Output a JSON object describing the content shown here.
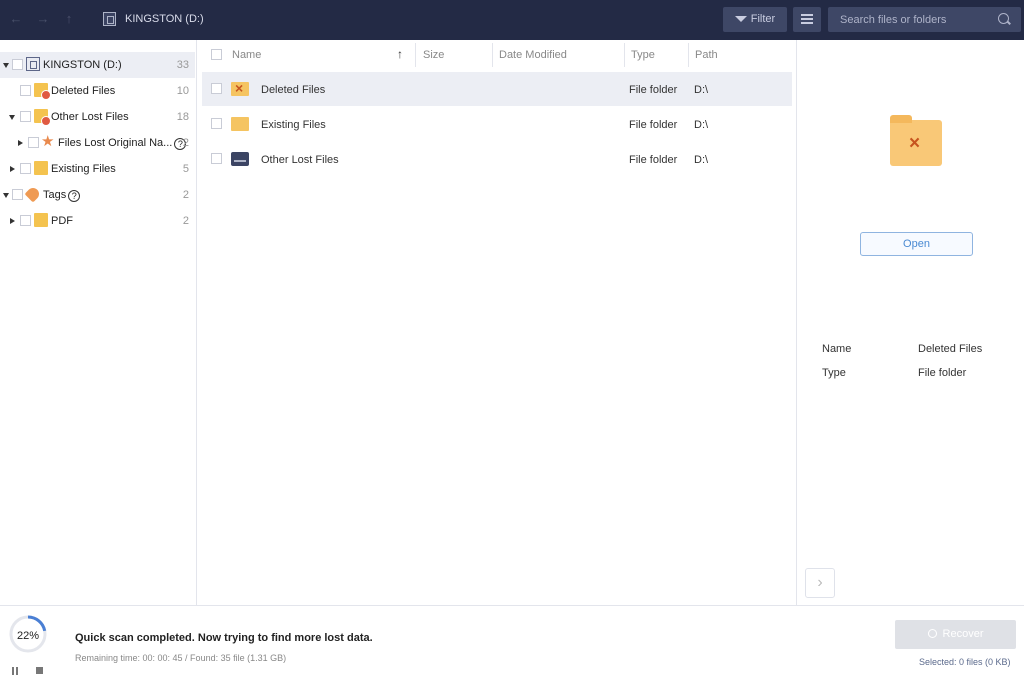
{
  "topbar": {
    "title": "KINGSTON (D:)",
    "filter_label": "Filter",
    "search_placeholder": "Search files or folders",
    "back_glyph": "←",
    "forward_glyph": "→",
    "up_glyph": "↑"
  },
  "tree": {
    "items": [
      {
        "label": "KINGSTON (D:)",
        "count": "33",
        "icon": "drive-icon"
      },
      {
        "label": "Deleted Files",
        "count": "10",
        "icon": "deleted-folder-icon"
      },
      {
        "label": "Other Lost Files",
        "count": "18",
        "icon": "lost-folder-icon"
      },
      {
        "label": "Files Lost Original Na...",
        "count": "2",
        "icon": "star-icon"
      },
      {
        "label": "Existing Files",
        "count": "5",
        "icon": "folder-icon"
      },
      {
        "label": "Tags",
        "count": "2",
        "icon": "tag-icon"
      },
      {
        "label": "PDF",
        "count": "2",
        "icon": "folder-icon"
      }
    ],
    "help_glyph": "?"
  },
  "list": {
    "columns": [
      "Name",
      "Size",
      "Date Modified",
      "Type",
      "Path"
    ],
    "sort_glyph": "↑",
    "rows": [
      {
        "name": "Deleted Files",
        "type": "File folder",
        "path": "D:\\"
      },
      {
        "name": "Existing Files",
        "type": "File folder",
        "path": "D:\\"
      },
      {
        "name": "Other Lost Files",
        "type": "File folder",
        "path": "D:\\"
      }
    ]
  },
  "preview": {
    "open_label": "Open",
    "name_label": "Name",
    "name_value": "Deleted Files",
    "type_label": "Type",
    "type_value": "File folder",
    "next_glyph": "›",
    "folder_glyph": "×"
  },
  "bottom": {
    "progress_percent": 22,
    "progress_text": "22%",
    "status": "Quick scan completed. Now trying to find more lost data.",
    "substatus": "Remaining time: 00: 00: 45 / Found: 35 file (1.31 GB)",
    "recover_label": "Recover",
    "selected_info": "Selected: 0 files (0 KB)"
  },
  "colors": {
    "topbar_bg": "#232a45",
    "accent": "#4a8ad2",
    "folder": "#f4c34f",
    "progress": "#4a7fd4"
  }
}
